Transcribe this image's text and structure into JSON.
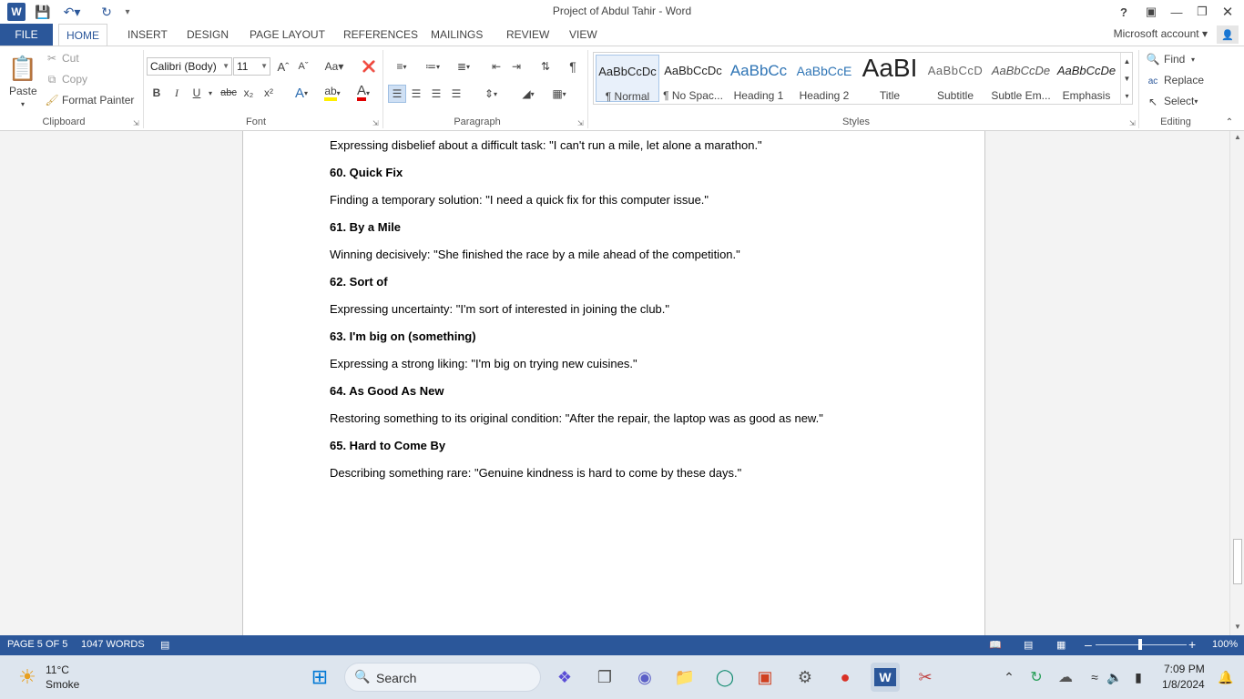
{
  "window": {
    "title": "Project of Abdul Tahir - Word",
    "help": "?",
    "controls": [
      "ribbon-display",
      "minimize",
      "restore",
      "close"
    ]
  },
  "tabs": [
    "FILE",
    "HOME",
    "INSERT",
    "DESIGN",
    "PAGE LAYOUT",
    "REFERENCES",
    "MAILINGS",
    "REVIEW",
    "VIEW"
  ],
  "active_tab": "HOME",
  "account": "Microsoft account",
  "clipboard": {
    "paste": "Paste",
    "cut": "Cut",
    "copy": "Copy",
    "format_painter": "Format Painter",
    "label": "Clipboard"
  },
  "font": {
    "name": "Calibri (Body)",
    "size": "11",
    "label": "Font",
    "bold": "B",
    "italic": "I",
    "underline": "U",
    "strike": "abc",
    "sub": "x₂",
    "sup": "x²"
  },
  "paragraph": {
    "label": "Paragraph"
  },
  "styles": {
    "label": "Styles",
    "items": [
      {
        "sample": "AaBbCcDc",
        "name": "¶ Normal"
      },
      {
        "sample": "AaBbCcDc",
        "name": "¶ No Spac..."
      },
      {
        "sample": "AaBbCc",
        "name": "Heading 1"
      },
      {
        "sample": "AaBbCcE",
        "name": "Heading 2"
      },
      {
        "sample": "AaBI",
        "name": "Title"
      },
      {
        "sample": "AaBbCcD",
        "name": "Subtitle"
      },
      {
        "sample": "AaBbCcDe",
        "name": "Subtle Em..."
      },
      {
        "sample": "AaBbCcDe",
        "name": "Emphasis"
      }
    ]
  },
  "editing": {
    "label": "Editing",
    "find": "Find",
    "replace": "Replace",
    "select": "Select"
  },
  "document": {
    "paragraphs": [
      {
        "text": "Expressing disbelief about a difficult task: \"I can't run a mile, let alone a marathon.\"",
        "heading": false
      },
      {
        "text": "60. Quick Fix",
        "heading": true
      },
      {
        "text": "Finding a temporary solution: \"I need a quick fix for this computer issue.\"",
        "heading": false
      },
      {
        "text": "61. By a Mile",
        "heading": true
      },
      {
        "text": "Winning decisively: \"She finished the race by a mile ahead of the competition.\"",
        "heading": false
      },
      {
        "text": "62. Sort of",
        "heading": true
      },
      {
        "text": "Expressing uncertainty: \"I'm sort of interested in joining the club.\"",
        "heading": false
      },
      {
        "text": "63. I'm big on (something)",
        "heading": true
      },
      {
        "text": "Expressing a strong liking: \"I'm big on trying new cuisines.\"",
        "heading": false
      },
      {
        "text": "64. As Good As New",
        "heading": true
      },
      {
        "text": "Restoring something to its original condition: \"After the repair, the laptop was as good as new.\"",
        "heading": false
      },
      {
        "text": "65. Hard to Come By",
        "heading": true
      },
      {
        "text": "Describing something rare: \"Genuine kindness is hard to come by these days.\"",
        "heading": false
      }
    ]
  },
  "status": {
    "page": "PAGE 5 OF 5",
    "words": "1047 WORDS",
    "zoom": "100%",
    "zoom_level_percent": 100
  },
  "taskbar": {
    "weather_temp": "11°C",
    "weather_desc": "Smoke",
    "search_label": "Search",
    "time": "7:09 PM",
    "date": "1/8/2024"
  },
  "colors": {
    "accent": "#2b579a",
    "taskbar": "#dde5ee"
  }
}
